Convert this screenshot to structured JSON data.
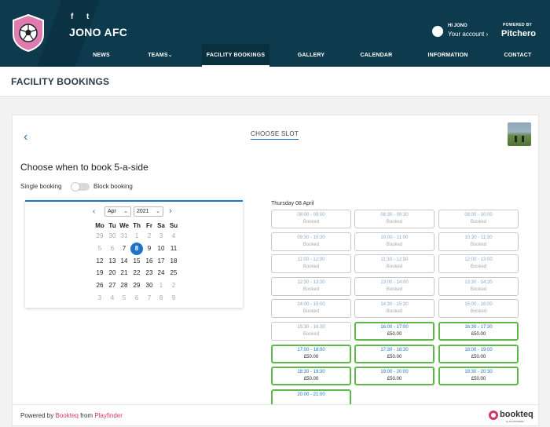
{
  "header": {
    "club_name": "JONO AFC",
    "social": [
      "f",
      "t"
    ],
    "account_greeting": "HI JONO",
    "account_link": "Your account",
    "powered_by": "POWERED BY",
    "brand": "Pitchero",
    "brand_color": "#0d3a4c"
  },
  "nav": {
    "items": [
      {
        "label": "NEWS"
      },
      {
        "label": "TEAMS"
      },
      {
        "label": "FACILITY BOOKINGS",
        "active": true
      },
      {
        "label": "GALLERY"
      },
      {
        "label": "CALENDAR"
      },
      {
        "label": "INFORMATION"
      },
      {
        "label": "CONTACT"
      }
    ]
  },
  "page": {
    "title": "FACILITY BOOKINGS"
  },
  "widget": {
    "step_title": "CHOOSE SLOT",
    "heading": "Choose when to book 5-a-side",
    "toggle_left": "Single booking",
    "toggle_right": "Block booking",
    "accent_color": "#1e74c8"
  },
  "calendar": {
    "month": "Apr",
    "year": "2021",
    "weekdays": [
      "Mo",
      "Tu",
      "We",
      "Th",
      "Fr",
      "Sa",
      "Su"
    ],
    "weeks": [
      [
        {
          "d": "29",
          "m": true
        },
        {
          "d": "30",
          "m": true
        },
        {
          "d": "31",
          "m": true
        },
        {
          "d": "1",
          "m": true
        },
        {
          "d": "2",
          "m": true
        },
        {
          "d": "3",
          "m": true
        },
        {
          "d": "4",
          "m": true
        }
      ],
      [
        {
          "d": "5",
          "m": true
        },
        {
          "d": "6",
          "m": true
        },
        {
          "d": "7"
        },
        {
          "d": "8",
          "sel": true
        },
        {
          "d": "9"
        },
        {
          "d": "10"
        },
        {
          "d": "11"
        }
      ],
      [
        {
          "d": "12"
        },
        {
          "d": "13"
        },
        {
          "d": "14"
        },
        {
          "d": "15"
        },
        {
          "d": "16"
        },
        {
          "d": "17"
        },
        {
          "d": "18"
        }
      ],
      [
        {
          "d": "19"
        },
        {
          "d": "20"
        },
        {
          "d": "21"
        },
        {
          "d": "22"
        },
        {
          "d": "23"
        },
        {
          "d": "24"
        },
        {
          "d": "25"
        }
      ],
      [
        {
          "d": "26"
        },
        {
          "d": "27"
        },
        {
          "d": "28"
        },
        {
          "d": "29"
        },
        {
          "d": "30"
        },
        {
          "d": "1",
          "m": true
        },
        {
          "d": "2",
          "m": true
        }
      ],
      [
        {
          "d": "3",
          "m": true
        },
        {
          "d": "4",
          "m": true
        },
        {
          "d": "5",
          "m": true
        },
        {
          "d": "6",
          "m": true
        },
        {
          "d": "7",
          "m": true
        },
        {
          "d": "8",
          "m": true
        },
        {
          "d": "9",
          "m": true
        }
      ]
    ]
  },
  "slots": {
    "date_label": "Thursday 08 April",
    "items": [
      {
        "time": "08:00 - 09:00",
        "status": "Booked"
      },
      {
        "time": "08:30 - 09:30",
        "status": "Booked"
      },
      {
        "time": "09:00 - 10:00",
        "status": "Booked"
      },
      {
        "time": "09:30 - 10:30",
        "status": "Booked"
      },
      {
        "time": "10:00 - 11:00",
        "status": "Booked"
      },
      {
        "time": "10:30 - 11:30",
        "status": "Booked"
      },
      {
        "time": "11:00 - 12:00",
        "status": "Booked"
      },
      {
        "time": "11:30 - 12:30",
        "status": "Booked"
      },
      {
        "time": "12:00 - 13:00",
        "status": "Booked"
      },
      {
        "time": "12:30 - 13:30",
        "status": "Booked"
      },
      {
        "time": "13:00 - 14:00",
        "status": "Booked"
      },
      {
        "time": "13:30 - 14:30",
        "status": "Booked"
      },
      {
        "time": "14:00 - 15:00",
        "status": "Booked"
      },
      {
        "time": "14:30 - 15:30",
        "status": "Booked"
      },
      {
        "time": "15:00 - 16:00",
        "status": "Booked"
      },
      {
        "time": "15:30 - 16:30",
        "status": "Booked"
      },
      {
        "time": "16:00 - 17:00",
        "status": "£50.00",
        "available": true
      },
      {
        "time": "16:30 - 17:30",
        "status": "£50.00",
        "available": true
      },
      {
        "time": "17:00 - 18:00",
        "status": "£50.00",
        "available": true
      },
      {
        "time": "17:30 - 18:30",
        "status": "£50.00",
        "available": true
      },
      {
        "time": "18:00 - 19:00",
        "status": "£50.00",
        "available": true
      },
      {
        "time": "18:30 - 19:30",
        "status": "£50.00",
        "available": true
      },
      {
        "time": "19:00 - 20:00",
        "status": "£50.00",
        "available": true
      },
      {
        "time": "19:30 - 20:30",
        "status": "£50.00",
        "available": true
      },
      {
        "time": "20:00 - 21:00",
        "status": "",
        "available": true
      }
    ]
  },
  "footer": {
    "powered_by": "Powered by",
    "bookteq": "Bookteq",
    "from": "from",
    "playfinder": "Playfinder",
    "logo_name": "bookteq",
    "logo_sub": "by PLAYFINDER",
    "logo_color": "#d23a64"
  }
}
